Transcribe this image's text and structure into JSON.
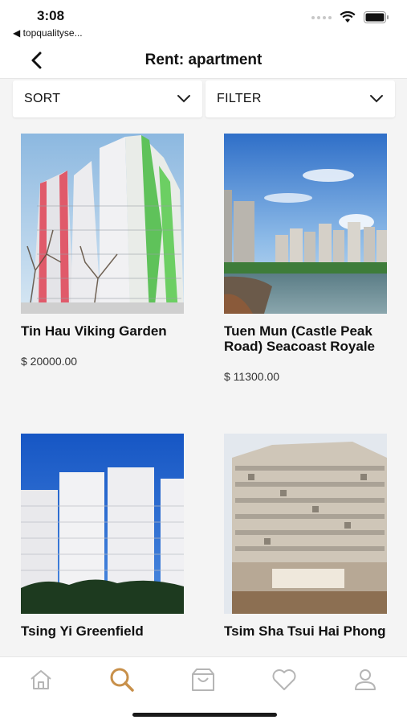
{
  "status": {
    "time": "3:08",
    "back_app": "◀ topqualityse..."
  },
  "nav": {
    "title": "Rent: apartment"
  },
  "toolbar": {
    "sort_label": "SORT",
    "filter_label": "FILTER"
  },
  "listings": [
    {
      "name": "Tin Hau Viking Garden",
      "price": "$ 20000.00"
    },
    {
      "name": "Tuen Mun (Castle Peak Road) Seacoast Royale",
      "price": "$ 11300.00"
    },
    {
      "name": "Tsing Yi Greenfield",
      "price": ""
    },
    {
      "name": "Tsim Sha Tsui Hai Phong",
      "price": ""
    }
  ],
  "tabs": [
    {
      "icon": "home-icon",
      "active": false
    },
    {
      "icon": "search-icon",
      "active": true
    },
    {
      "icon": "shopping-bag-icon",
      "active": false
    },
    {
      "icon": "heart-icon",
      "active": false
    },
    {
      "icon": "profile-icon",
      "active": false
    }
  ],
  "colors": {
    "accent": "#c8904a",
    "inactive_icon": "#b5b5b5",
    "background": "#f4f4f4"
  }
}
